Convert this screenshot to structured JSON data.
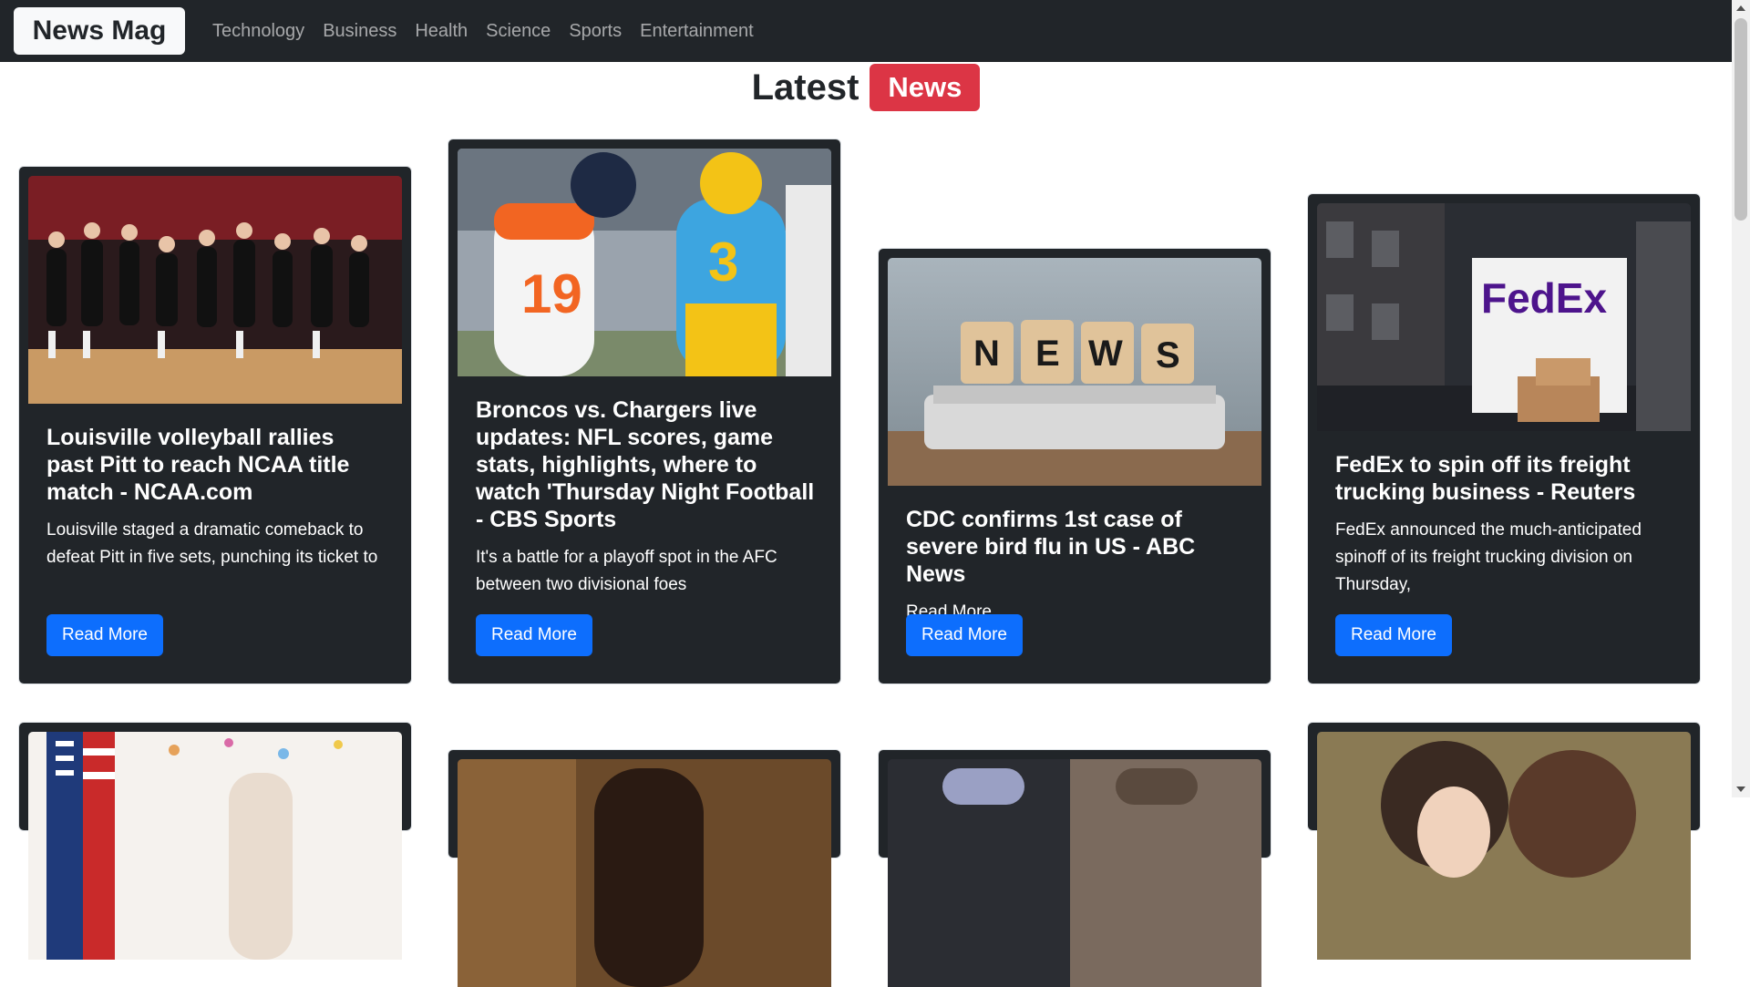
{
  "navbar": {
    "brand": "News Mag",
    "links": [
      "Technology",
      "Business",
      "Health",
      "Science",
      "Sports",
      "Entertainment"
    ]
  },
  "heading": {
    "text": "Latest",
    "badge": "News"
  },
  "cards": [
    {
      "title": "Louisville volleyball rallies past Pitt to reach NCAA title match - NCAA.com",
      "description": "Louisville staged a dramatic comeback to defeat Pitt in five sets, punching its ticket to",
      "button": "Read More",
      "image": "volleyball-team-celebration"
    },
    {
      "title": "Broncos vs. Chargers live updates: NFL scores, game stats, highlights, where to watch 'Thursday Night Football - CBS Sports",
      "description": "It's a battle for a playoff spot in the AFC between two divisional foes",
      "button": "Read More",
      "image": "football-players-running"
    },
    {
      "title": "CDC confirms 1st case of severe bird flu in US - ABC News",
      "description": "Read More....",
      "button": "Read More",
      "image": "news-blocks-on-newspapers"
    },
    {
      "title": "FedEx to spin off its freight trucking business - Reuters",
      "description": "FedEx announced the much-anticipated spinoff of its freight trucking division on Thursday,",
      "button": "Read More",
      "image": "fedex-delivery-truck",
      "image_text": "FedEx"
    }
  ],
  "colors": {
    "navbar": "#212529",
    "card": "#212529",
    "badge": "#dc3545",
    "button": "#0d6efd"
  }
}
